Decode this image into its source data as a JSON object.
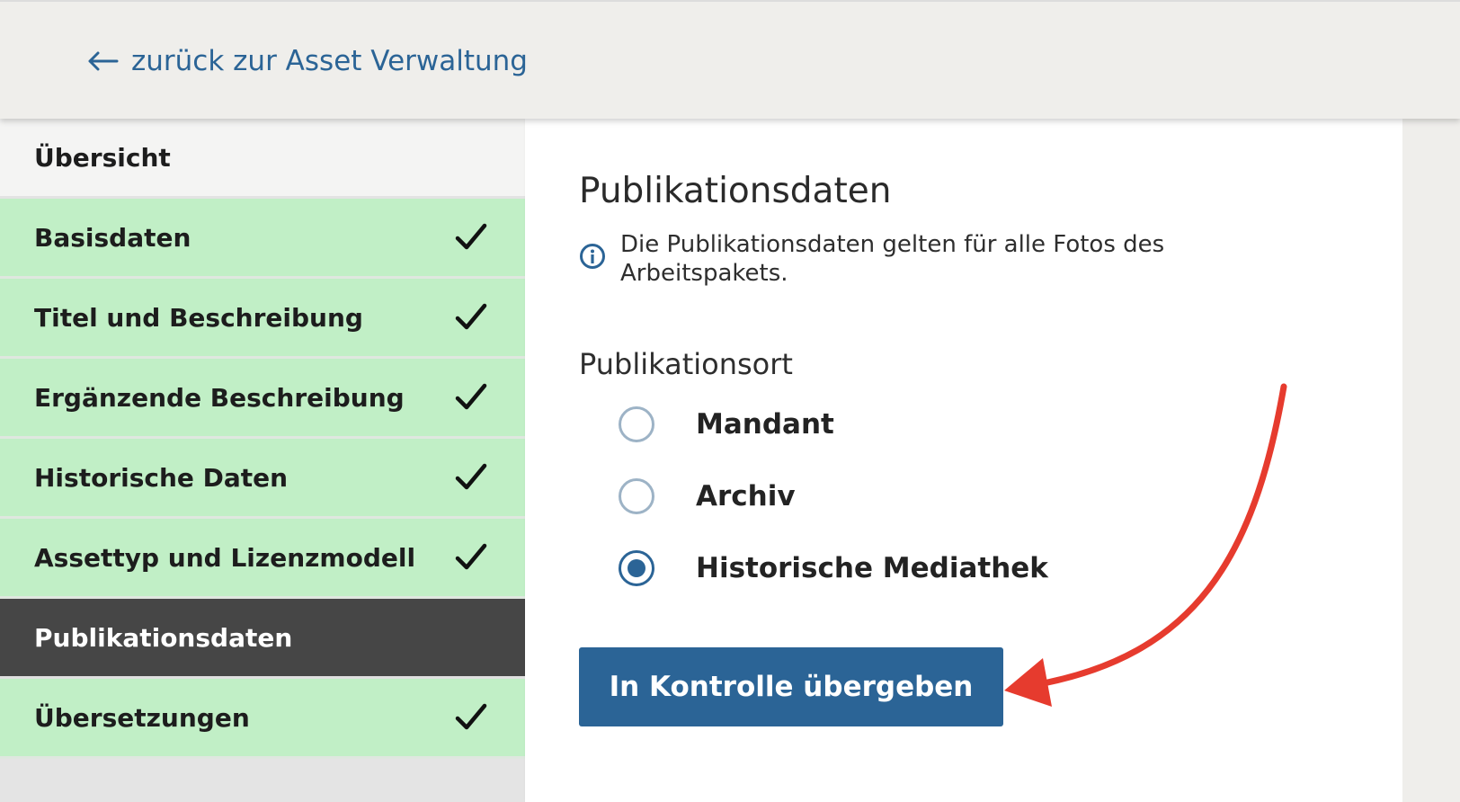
{
  "header": {
    "back_link_label": "zurück zur Asset Verwaltung",
    "back_icon": "arrow-left-icon"
  },
  "sidebar": {
    "items": [
      {
        "label": "Übersicht",
        "state": "overview"
      },
      {
        "label": "Basisdaten",
        "state": "done"
      },
      {
        "label": "Titel und Beschreibung",
        "state": "done"
      },
      {
        "label": "Ergänzende Beschreibung",
        "state": "done"
      },
      {
        "label": "Historische Daten",
        "state": "done"
      },
      {
        "label": "Assettyp und Lizenzmodell",
        "state": "done"
      },
      {
        "label": "Publikationsdaten",
        "state": "active"
      },
      {
        "label": "Übersetzungen",
        "state": "done"
      }
    ],
    "done_icon": "checkmark-icon"
  },
  "main": {
    "title": "Publikationsdaten",
    "info_text": "Die Publikationsdaten gelten für alle Fotos des Arbeitspakets.",
    "info_icon": "info-circle-icon",
    "field_label": "Publikationsort",
    "options": [
      {
        "label": "Mandant",
        "checked": false
      },
      {
        "label": "Archiv",
        "checked": false
      },
      {
        "label": "Historische Mediathek",
        "checked": true
      }
    ],
    "submit_label": "In Kontrolle übergeben"
  },
  "colors": {
    "accent": "#2b6496",
    "done_bg": "#c1efc6",
    "active_bg": "#464646",
    "annotation_arrow": "#e63b2e"
  }
}
